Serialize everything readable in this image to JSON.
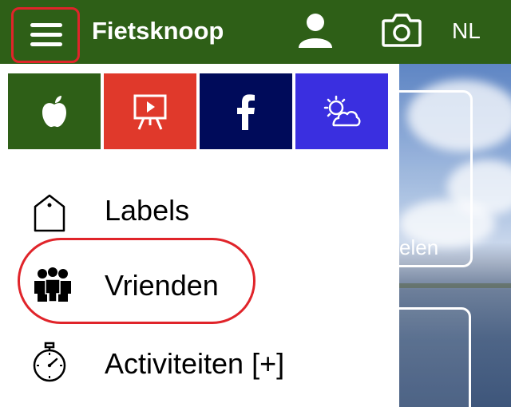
{
  "app": {
    "title": "Fietsknoop",
    "language": "NL"
  },
  "colors": {
    "bar": "#2e5f17",
    "highlight": "#e0242a",
    "tile_apple": "#2e5f17",
    "tile_presentation": "#e0392b",
    "tile_facebook": "#000b5a",
    "tile_weather": "#3a2fe0"
  },
  "tiles": [
    {
      "icon": "apple-icon"
    },
    {
      "icon": "presentation-icon"
    },
    {
      "icon": "facebook-icon"
    },
    {
      "icon": "weather-icon"
    }
  ],
  "menu": {
    "items": [
      {
        "label": "Labels",
        "icon": "tag-icon"
      },
      {
        "label": "Vrienden",
        "icon": "group-icon"
      },
      {
        "label": "Activiteiten [+]",
        "icon": "stopwatch-icon"
      }
    ]
  },
  "background": {
    "card_label": "elen"
  }
}
